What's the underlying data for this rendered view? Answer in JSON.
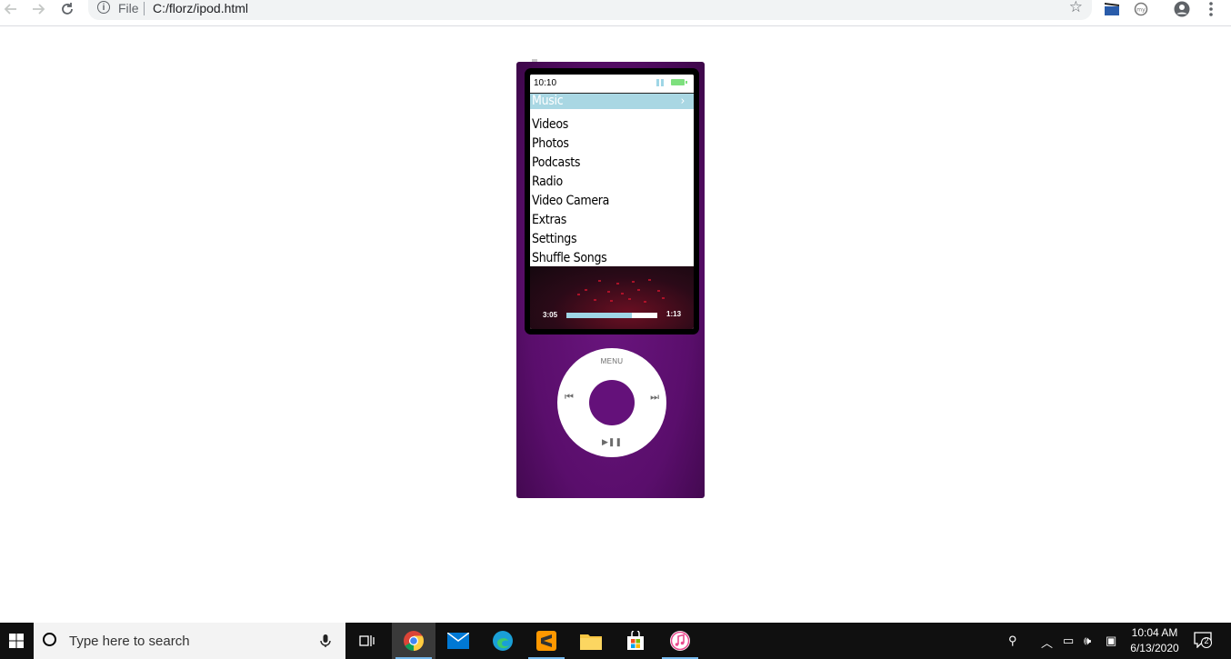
{
  "browser": {
    "file_label": "File",
    "url": "C:/florz/ipod.html"
  },
  "ipod": {
    "clock": "10:10",
    "menu": [
      {
        "label": "Music",
        "selected": true
      },
      {
        "label": "Videos"
      },
      {
        "label": "Photos"
      },
      {
        "label": "Podcasts"
      },
      {
        "label": "Radio"
      },
      {
        "label": "Video Camera"
      },
      {
        "label": "Extras"
      },
      {
        "label": "Settings"
      },
      {
        "label": "Shuffle Songs"
      }
    ],
    "now_playing": {
      "elapsed": "3:05",
      "remaining": "1:13",
      "progress_fraction": 0.72
    },
    "wheel": {
      "menu_label": "MENU",
      "prev_symbol": "⏮",
      "next_symbol": "⏭",
      "play_pause_symbol": "▶❚❚"
    },
    "colors": {
      "body": "#5a0e6c",
      "highlight": "#a9d7e3",
      "battery": "#7ee07e"
    }
  },
  "taskbar": {
    "search_placeholder": "Type here to search",
    "time": "10:04 AM",
    "date": "6/13/2020",
    "notification_count": "2",
    "apps": [
      "task-view",
      "chrome",
      "mail",
      "edge",
      "sublime-text",
      "file-explorer",
      "microsoft-store",
      "itunes"
    ]
  }
}
